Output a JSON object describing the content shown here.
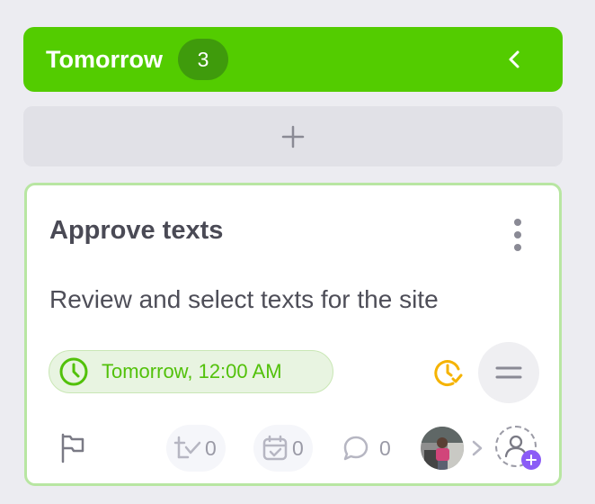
{
  "column": {
    "title": "Tomorrow",
    "count": "3",
    "accent_color": "#53cc00",
    "collapse_icon": "chevron-left-icon"
  },
  "add_button": {
    "icon": "plus-icon"
  },
  "card": {
    "title": "Approve texts",
    "description": "Review and select texts for the site",
    "due": "Tomorrow, 12:00 AM",
    "menu_icon": "kebab-menu-icon",
    "timer_icon": "clock-check-icon",
    "priority_icon": "equals-icon",
    "flag_icon": "flag-icon",
    "stats": {
      "checklist": "0",
      "subtasks": "0",
      "comments": "0"
    },
    "assignee_avatar": "avatar",
    "add_assignee_icon": "add-user-icon"
  }
}
